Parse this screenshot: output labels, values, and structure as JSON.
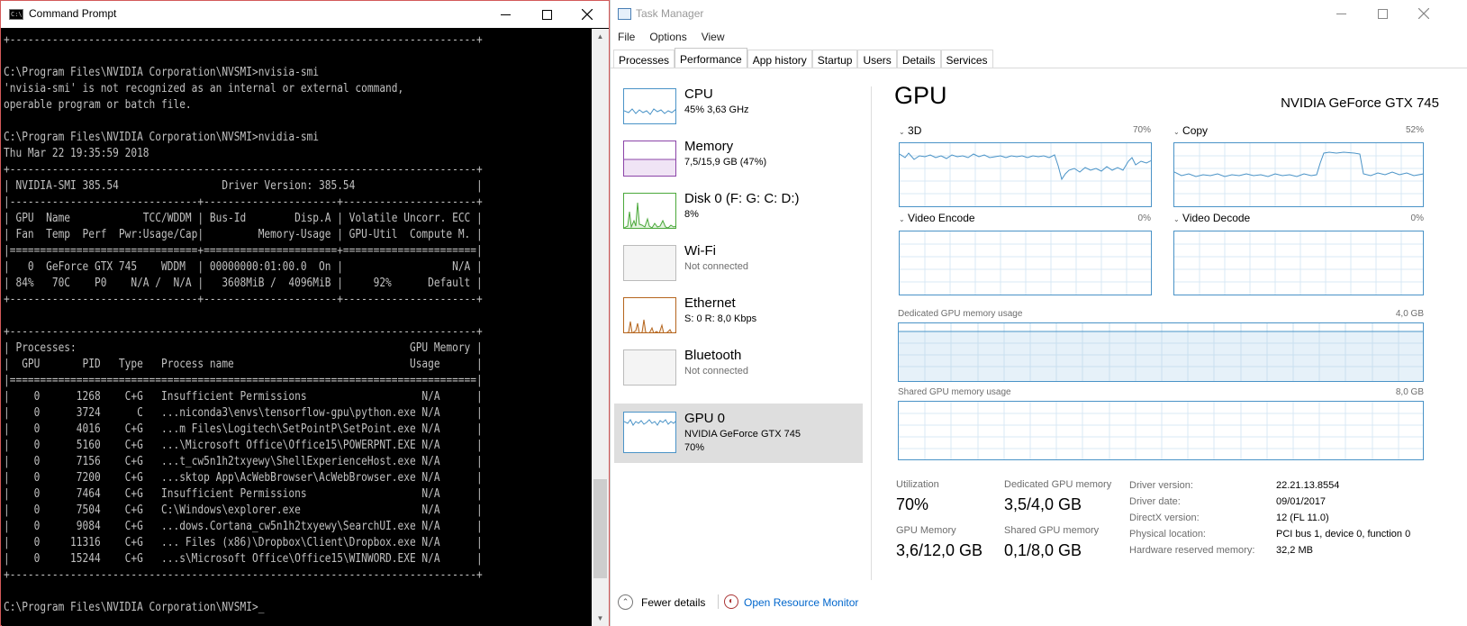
{
  "cmd": {
    "title": "Command Prompt",
    "lines": [
      "+-----------------------------------------------------------------------------+",
      "",
      "C:\\Program Files\\NVIDIA Corporation\\NVSMI>nvisia-smi",
      "'nvisia-smi' is not recognized as an internal or external command,",
      "operable program or batch file.",
      "",
      "C:\\Program Files\\NVIDIA Corporation\\NVSMI>nvidia-smi",
      "Thu Mar 22 19:35:59 2018",
      "+-----------------------------------------------------------------------------+",
      "| NVIDIA-SMI 385.54                 Driver Version: 385.54                    |",
      "|-------------------------------+----------------------+----------------------+",
      "| GPU  Name            TCC/WDDM | Bus-Id        Disp.A | Volatile Uncorr. ECC |",
      "| Fan  Temp  Perf  Pwr:Usage/Cap|         Memory-Usage | GPU-Util  Compute M. |",
      "|===============================+======================+======================|",
      "|   0  GeForce GTX 745    WDDM  | 00000000:01:00.0  On |                  N/A |",
      "| 84%   70C    P0    N/A /  N/A |   3608MiB /  4096MiB |     92%      Default |",
      "+-------------------------------+----------------------+----------------------+",
      "",
      "+-----------------------------------------------------------------------------+",
      "| Processes:                                                       GPU Memory |",
      "|  GPU       PID   Type   Process name                             Usage      |",
      "|=============================================================================|",
      "|    0      1268    C+G   Insufficient Permissions                   N/A      |",
      "|    0      3724      C   ...niconda3\\envs\\tensorflow-gpu\\python.exe N/A      |",
      "|    0      4016    C+G   ...m Files\\Logitech\\SetPointP\\SetPoint.exe N/A      |",
      "|    0      5160    C+G   ...\\Microsoft Office\\Office15\\POWERPNT.EXE N/A      |",
      "|    0      7156    C+G   ...t_cw5n1h2txyewy\\ShellExperienceHost.exe N/A      |",
      "|    0      7200    C+G   ...sktop App\\AcWebBrowser\\AcWebBrowser.exe N/A      |",
      "|    0      7464    C+G   Insufficient Permissions                   N/A      |",
      "|    0      7504    C+G   C:\\Windows\\explorer.exe                    N/A      |",
      "|    0      9084    C+G   ...dows.Cortana_cw5n1h2txyewy\\SearchUI.exe N/A      |",
      "|    0     11316    C+G   ... Files (x86)\\Dropbox\\Client\\Dropbox.exe N/A      |",
      "|    0     15244    C+G   ...s\\Microsoft Office\\Office15\\WINWORD.EXE N/A      |",
      "+-----------------------------------------------------------------------------+",
      "",
      "C:\\Program Files\\NVIDIA Corporation\\NVSMI>_"
    ]
  },
  "tm": {
    "title": "Task Manager",
    "menu": [
      "File",
      "Options",
      "View"
    ],
    "tabs": [
      "Processes",
      "Performance",
      "App history",
      "Startup",
      "Users",
      "Details",
      "Services"
    ],
    "active_tab": "Performance",
    "perf_items": [
      {
        "name": "CPU",
        "sub1": "45% 3,63 GHz",
        "sub2": ""
      },
      {
        "name": "Memory",
        "sub1": "7,5/15,9 GB (47%)",
        "sub2": ""
      },
      {
        "name": "Disk 0 (F: G: C: D:)",
        "sub1": "8%",
        "sub2": ""
      },
      {
        "name": "Wi-Fi",
        "sub1": "Not connected",
        "sub2": ""
      },
      {
        "name": "Ethernet",
        "sub1": "S: 0 R: 8,0 Kbps",
        "sub2": ""
      },
      {
        "name": "Bluetooth",
        "sub1": "Not connected",
        "sub2": ""
      },
      {
        "name": "GPU 0",
        "sub1": "NVIDIA GeForce GTX 745",
        "sub2": "70%"
      }
    ],
    "gpu": {
      "heading": "GPU",
      "model": "NVIDIA GeForce GTX 745",
      "graphs": {
        "g3d": {
          "label": "3D",
          "pct": "70%"
        },
        "copy": {
          "label": "Copy",
          "pct": "52%"
        },
        "encode": {
          "label": "Video Encode",
          "pct": "0%"
        },
        "decode": {
          "label": "Video Decode",
          "pct": "0%"
        }
      },
      "dedicated": {
        "label": "Dedicated GPU memory usage",
        "max": "4,0 GB"
      },
      "shared": {
        "label": "Shared GPU memory usage",
        "max": "8,0 GB"
      },
      "stats": {
        "utilization_label": "Utilization",
        "utilization": "70%",
        "dedicated_label": "Dedicated GPU memory",
        "dedicated": "3,5/4,0 GB",
        "gpu_memory_label": "GPU Memory",
        "gpu_memory": "3,6/12,0 GB",
        "shared_label": "Shared GPU memory",
        "shared": "0,1/8,0 GB"
      },
      "info": [
        {
          "label": "Driver version:",
          "value": "22.21.13.8554"
        },
        {
          "label": "Driver date:",
          "value": "09/01/2017"
        },
        {
          "label": "DirectX version:",
          "value": "12 (FL 11.0)"
        },
        {
          "label": "Physical location:",
          "value": "PCI bus 1, device 0, function 0"
        },
        {
          "label": "Hardware reserved memory:",
          "value": "32,2 MB"
        }
      ]
    },
    "footer": {
      "fewer": "Fewer details",
      "resmon": "Open Resource Monitor"
    }
  },
  "colors": {
    "gpu_line": "#4a93c7",
    "memory_line": "#8b44a8",
    "disk_line": "#4aa83a",
    "ethernet_line": "#b5651d",
    "link": "#0066cc"
  }
}
